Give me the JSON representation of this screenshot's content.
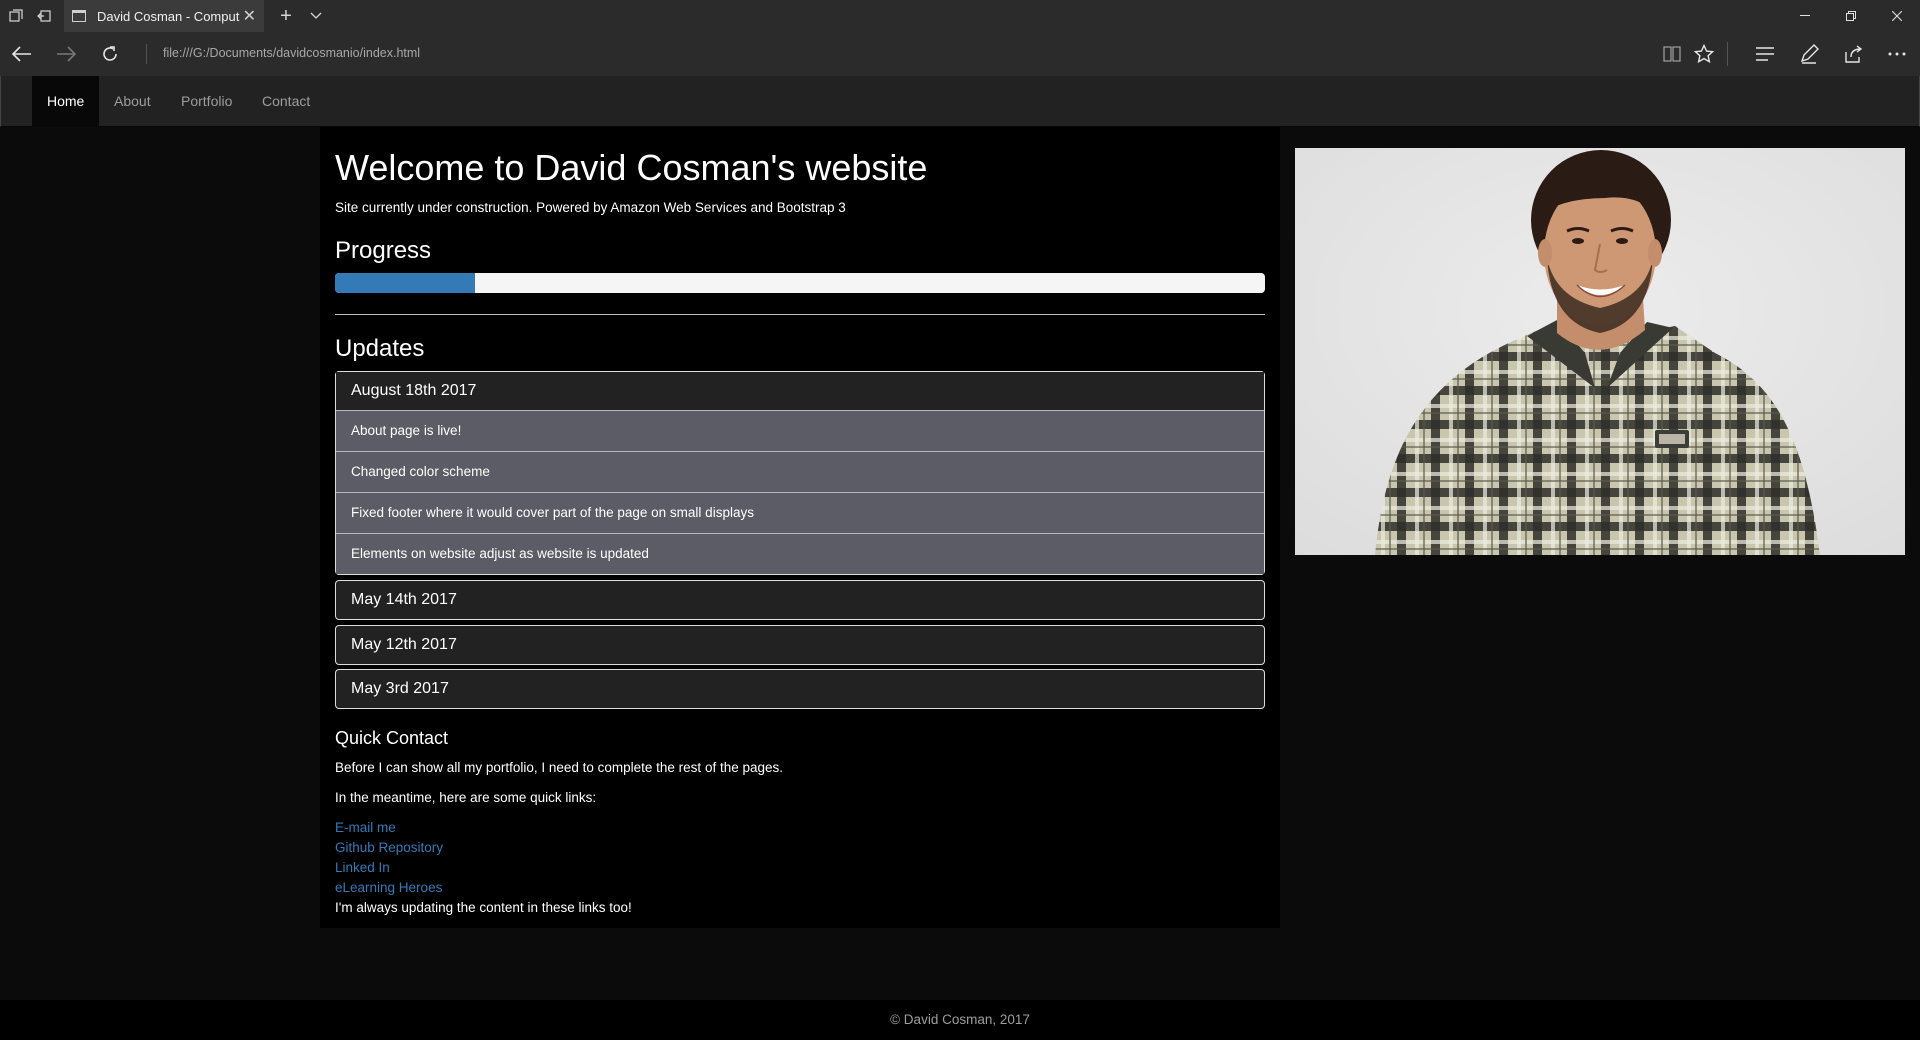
{
  "browser": {
    "tab_title": "David Cosman - Computer",
    "address": "file:///G:/Documents/davidcosmanio/index.html"
  },
  "navbar": {
    "items": [
      {
        "label": "Home",
        "active": true
      },
      {
        "label": "About",
        "active": false
      },
      {
        "label": "Portfolio",
        "active": false
      },
      {
        "label": "Contact",
        "active": false
      }
    ]
  },
  "main": {
    "title": "Welcome to David Cosman's website",
    "subtitle": "Site currently under construction. Powered by Amazon Web Services and Bootstrap 3",
    "progress_title": "Progress",
    "progress_percent": 15,
    "progress_color": "#337ab7",
    "updates_title": "Updates",
    "updates": [
      {
        "date": "August 18th 2017",
        "items": [
          "About page is live!",
          "Changed color scheme",
          "Fixed footer where it would cover part of the page on small displays",
          "Elements on website adjust as website is updated"
        ]
      },
      {
        "date": "May 14th 2017"
      },
      {
        "date": "May 12th 2017"
      },
      {
        "date": "May 3rd 2017"
      }
    ],
    "quick_contact": {
      "title": "Quick Contact",
      "intro": "Before I can show all my portfolio, I need to complete the rest of the pages.",
      "meantime": "In the meantime, here are some quick links:",
      "links": [
        "E-mail me",
        "Github Repository",
        "Linked In",
        "eLearning Heroes"
      ],
      "outro": "I'm always updating the content in these links too!"
    }
  },
  "footer": {
    "text": "© David Cosman, 2017"
  }
}
